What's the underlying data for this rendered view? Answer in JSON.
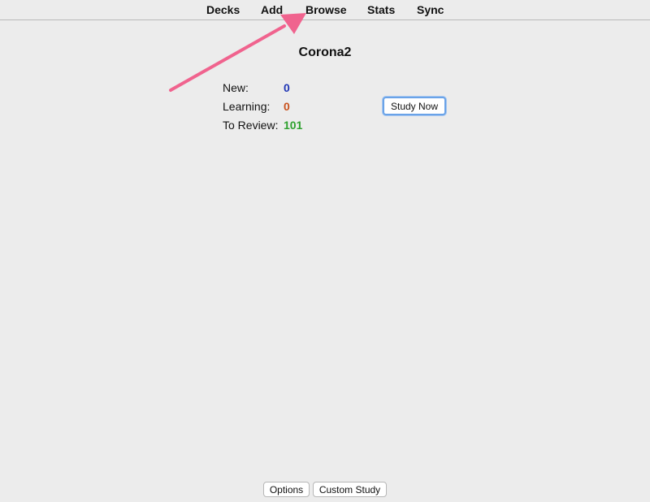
{
  "toolbar": {
    "items": [
      {
        "label": "Decks"
      },
      {
        "label": "Add"
      },
      {
        "label": "Browse"
      },
      {
        "label": "Stats"
      },
      {
        "label": "Sync"
      }
    ]
  },
  "deck": {
    "title": "Corona2",
    "counts": [
      {
        "label": "New:",
        "value": "0",
        "color": "#1f35b5"
      },
      {
        "label": "Learning:",
        "value": "0",
        "color": "#c8511c"
      },
      {
        "label": "To Review:",
        "value": "101",
        "color": "#2ea12e"
      }
    ],
    "study_button_label": "Study Now"
  },
  "bottom": {
    "options_label": "Options",
    "custom_study_label": "Custom Study"
  },
  "annotation": {
    "arrow_color": "#f0638e"
  }
}
